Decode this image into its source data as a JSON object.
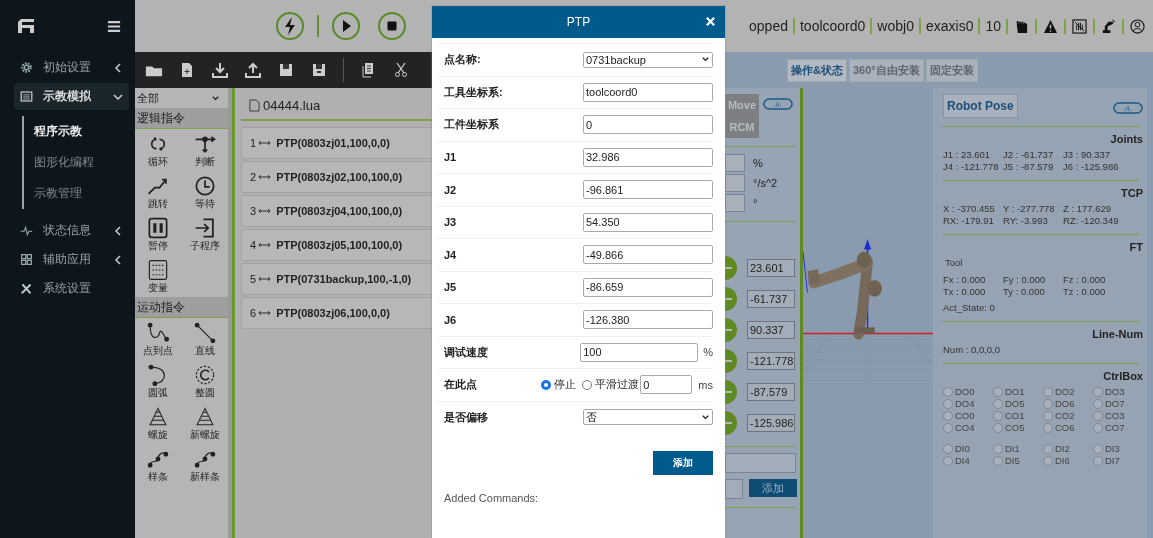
{
  "sidebar": {
    "menu": [
      {
        "label": "初始设置",
        "kind": "group",
        "expanded": false,
        "selected": false
      },
      {
        "label": "示教模拟",
        "kind": "group",
        "expanded": true,
        "selected": true,
        "children": [
          {
            "label": "程序示教",
            "selected": true
          },
          {
            "label": "图形化编程",
            "selected": false
          },
          {
            "label": "示教管理",
            "selected": false
          }
        ]
      },
      {
        "label": "状态信息",
        "kind": "group",
        "expanded": false,
        "selected": false
      },
      {
        "label": "辅助应用",
        "kind": "group",
        "expanded": false,
        "selected": false
      },
      {
        "label": "系统设置",
        "kind": "link",
        "selected": false
      }
    ]
  },
  "topbar": {
    "status": [
      "opped",
      "toolcoord0",
      "wobj0",
      "exaxis0",
      "10"
    ]
  },
  "palette": {
    "filter": "全部",
    "categories": [
      {
        "title": "逻辑指令",
        "items": [
          {
            "label": "循环"
          },
          {
            "label": "判断"
          },
          {
            "label": "跳转"
          },
          {
            "label": "等待"
          },
          {
            "label": "暂停"
          },
          {
            "label": "子程序"
          },
          {
            "label": "变量"
          }
        ]
      },
      {
        "title": "运动指令",
        "items": [
          {
            "label": "点到点"
          },
          {
            "label": "直线"
          },
          {
            "label": "圆弧"
          },
          {
            "label": "整圆"
          },
          {
            "label": "螺旋"
          },
          {
            "label": "新螺旋"
          },
          {
            "label": "样条"
          },
          {
            "label": "新样条"
          }
        ]
      }
    ]
  },
  "program": {
    "file": "04444.lua",
    "lines": [
      {
        "number": "1",
        "command": "PTP(0803zj01,100,0,0)"
      },
      {
        "number": "2",
        "command": "PTP(0803zj02,100,100,0)"
      },
      {
        "number": "3",
        "command": "PTP(0803zj04,100,100,0)"
      },
      {
        "number": "4",
        "command": "PTP(0803zj05,100,100,0)"
      },
      {
        "number": "5",
        "command": "PTP(0731backup,100,-1,0)"
      },
      {
        "number": "6",
        "command": "PTP(0803zj06,100,0,0)"
      }
    ]
  },
  "view": {
    "tabs": [
      {
        "label": "操作&状态",
        "selected": true
      },
      {
        "label": "360°自由安装",
        "selected": false
      },
      {
        "label": "固定安装",
        "selected": false
      }
    ],
    "mode_buttons": [
      "Move",
      "RCM"
    ],
    "units": [
      "%",
      "°/s^2",
      "°"
    ],
    "joints": [
      "23.601",
      "-61.737",
      "90.337",
      "-121.778",
      "-87.579",
      "-125.986"
    ],
    "add_button": "添加"
  },
  "pose": {
    "button": "Robot Pose",
    "joints": {
      "title": "Joints",
      "values": [
        "J1 : 23.601",
        "J2 : -61.737",
        "J3 : 90.337",
        "J4 : -121.778",
        "J5 : -87.579",
        "J6 : -125.986"
      ]
    },
    "tcp": {
      "title": "TCP",
      "values": [
        "X  : -370.455",
        "Y  : -277.778",
        "Z  : 177.629",
        "RX: -179.91",
        "RY: -3.993",
        "RZ: -120.349"
      ]
    },
    "ft": {
      "title": "FT",
      "tool": "Tool",
      "values": [
        "Fx : 0.000",
        "Fy : 0.000",
        "Fz : 0.000",
        "Tx : 0.000",
        "Ty : 0.000",
        "Tz : 0.000"
      ],
      "state": "Act_State: 0"
    },
    "line_num": {
      "title": "Line-Num",
      "value": "Num  :  0,0,0,0"
    },
    "ctrlbox": {
      "title": "CtrlBox",
      "outputs": [
        {
          "label": "DO0",
          "on": false
        },
        {
          "label": "DO1",
          "on": false
        },
        {
          "label": "DO2",
          "on": false
        },
        {
          "label": "DO3",
          "on": false
        },
        {
          "label": "DO4",
          "on": false
        },
        {
          "label": "DO5",
          "on": false
        },
        {
          "label": "DO6",
          "on": false
        },
        {
          "label": "DO7",
          "on": false
        },
        {
          "label": "CO0",
          "on": false
        },
        {
          "label": "CO1",
          "on": false
        },
        {
          "label": "CO2",
          "on": false
        },
        {
          "label": "CO3",
          "on": false
        },
        {
          "label": "CO4",
          "on": false
        },
        {
          "label": "CO5",
          "on": false
        },
        {
          "label": "CO6",
          "on": false
        },
        {
          "label": "CO7",
          "on": false
        }
      ],
      "inputs": [
        {
          "label": "DI0",
          "on": false
        },
        {
          "label": "DI1",
          "on": false
        },
        {
          "label": "DI2",
          "on": false
        },
        {
          "label": "DI3",
          "on": false
        },
        {
          "label": "DI4",
          "on": false
        },
        {
          "label": "DI5",
          "on": false
        },
        {
          "label": "DI6",
          "on": false
        },
        {
          "label": "DI7",
          "on": false
        }
      ]
    }
  },
  "dialog": {
    "title": "PTP",
    "fields": [
      {
        "label": "点名称:",
        "kind": "select",
        "value": "0731backup"
      },
      {
        "label": "工具坐标系:",
        "kind": "text",
        "value": "toolcoord0"
      },
      {
        "label": "工件坐标系",
        "kind": "text",
        "value": "0"
      },
      {
        "label": "J1",
        "kind": "text",
        "value": "32.986"
      },
      {
        "label": "J2",
        "kind": "text",
        "value": "-96.861"
      },
      {
        "label": "J3",
        "kind": "text",
        "value": "54.350"
      },
      {
        "label": "J4",
        "kind": "text",
        "value": "-49.866"
      },
      {
        "label": "J5",
        "kind": "text",
        "value": "-86.659"
      },
      {
        "label": "J6",
        "kind": "text",
        "value": "-126.380"
      },
      {
        "label": "调试速度",
        "kind": "unit",
        "value": "100",
        "unit": "%"
      },
      {
        "label": "在此点",
        "kind": "radio",
        "options": [
          {
            "label": "停止",
            "selected": true
          },
          {
            "label": "平滑过渡",
            "selected": false
          }
        ],
        "value": "0",
        "unit": "ms"
      },
      {
        "label": "是否偏移",
        "kind": "select",
        "value": "否"
      }
    ],
    "add_button": "添加",
    "added_label": "Added Commands:"
  }
}
